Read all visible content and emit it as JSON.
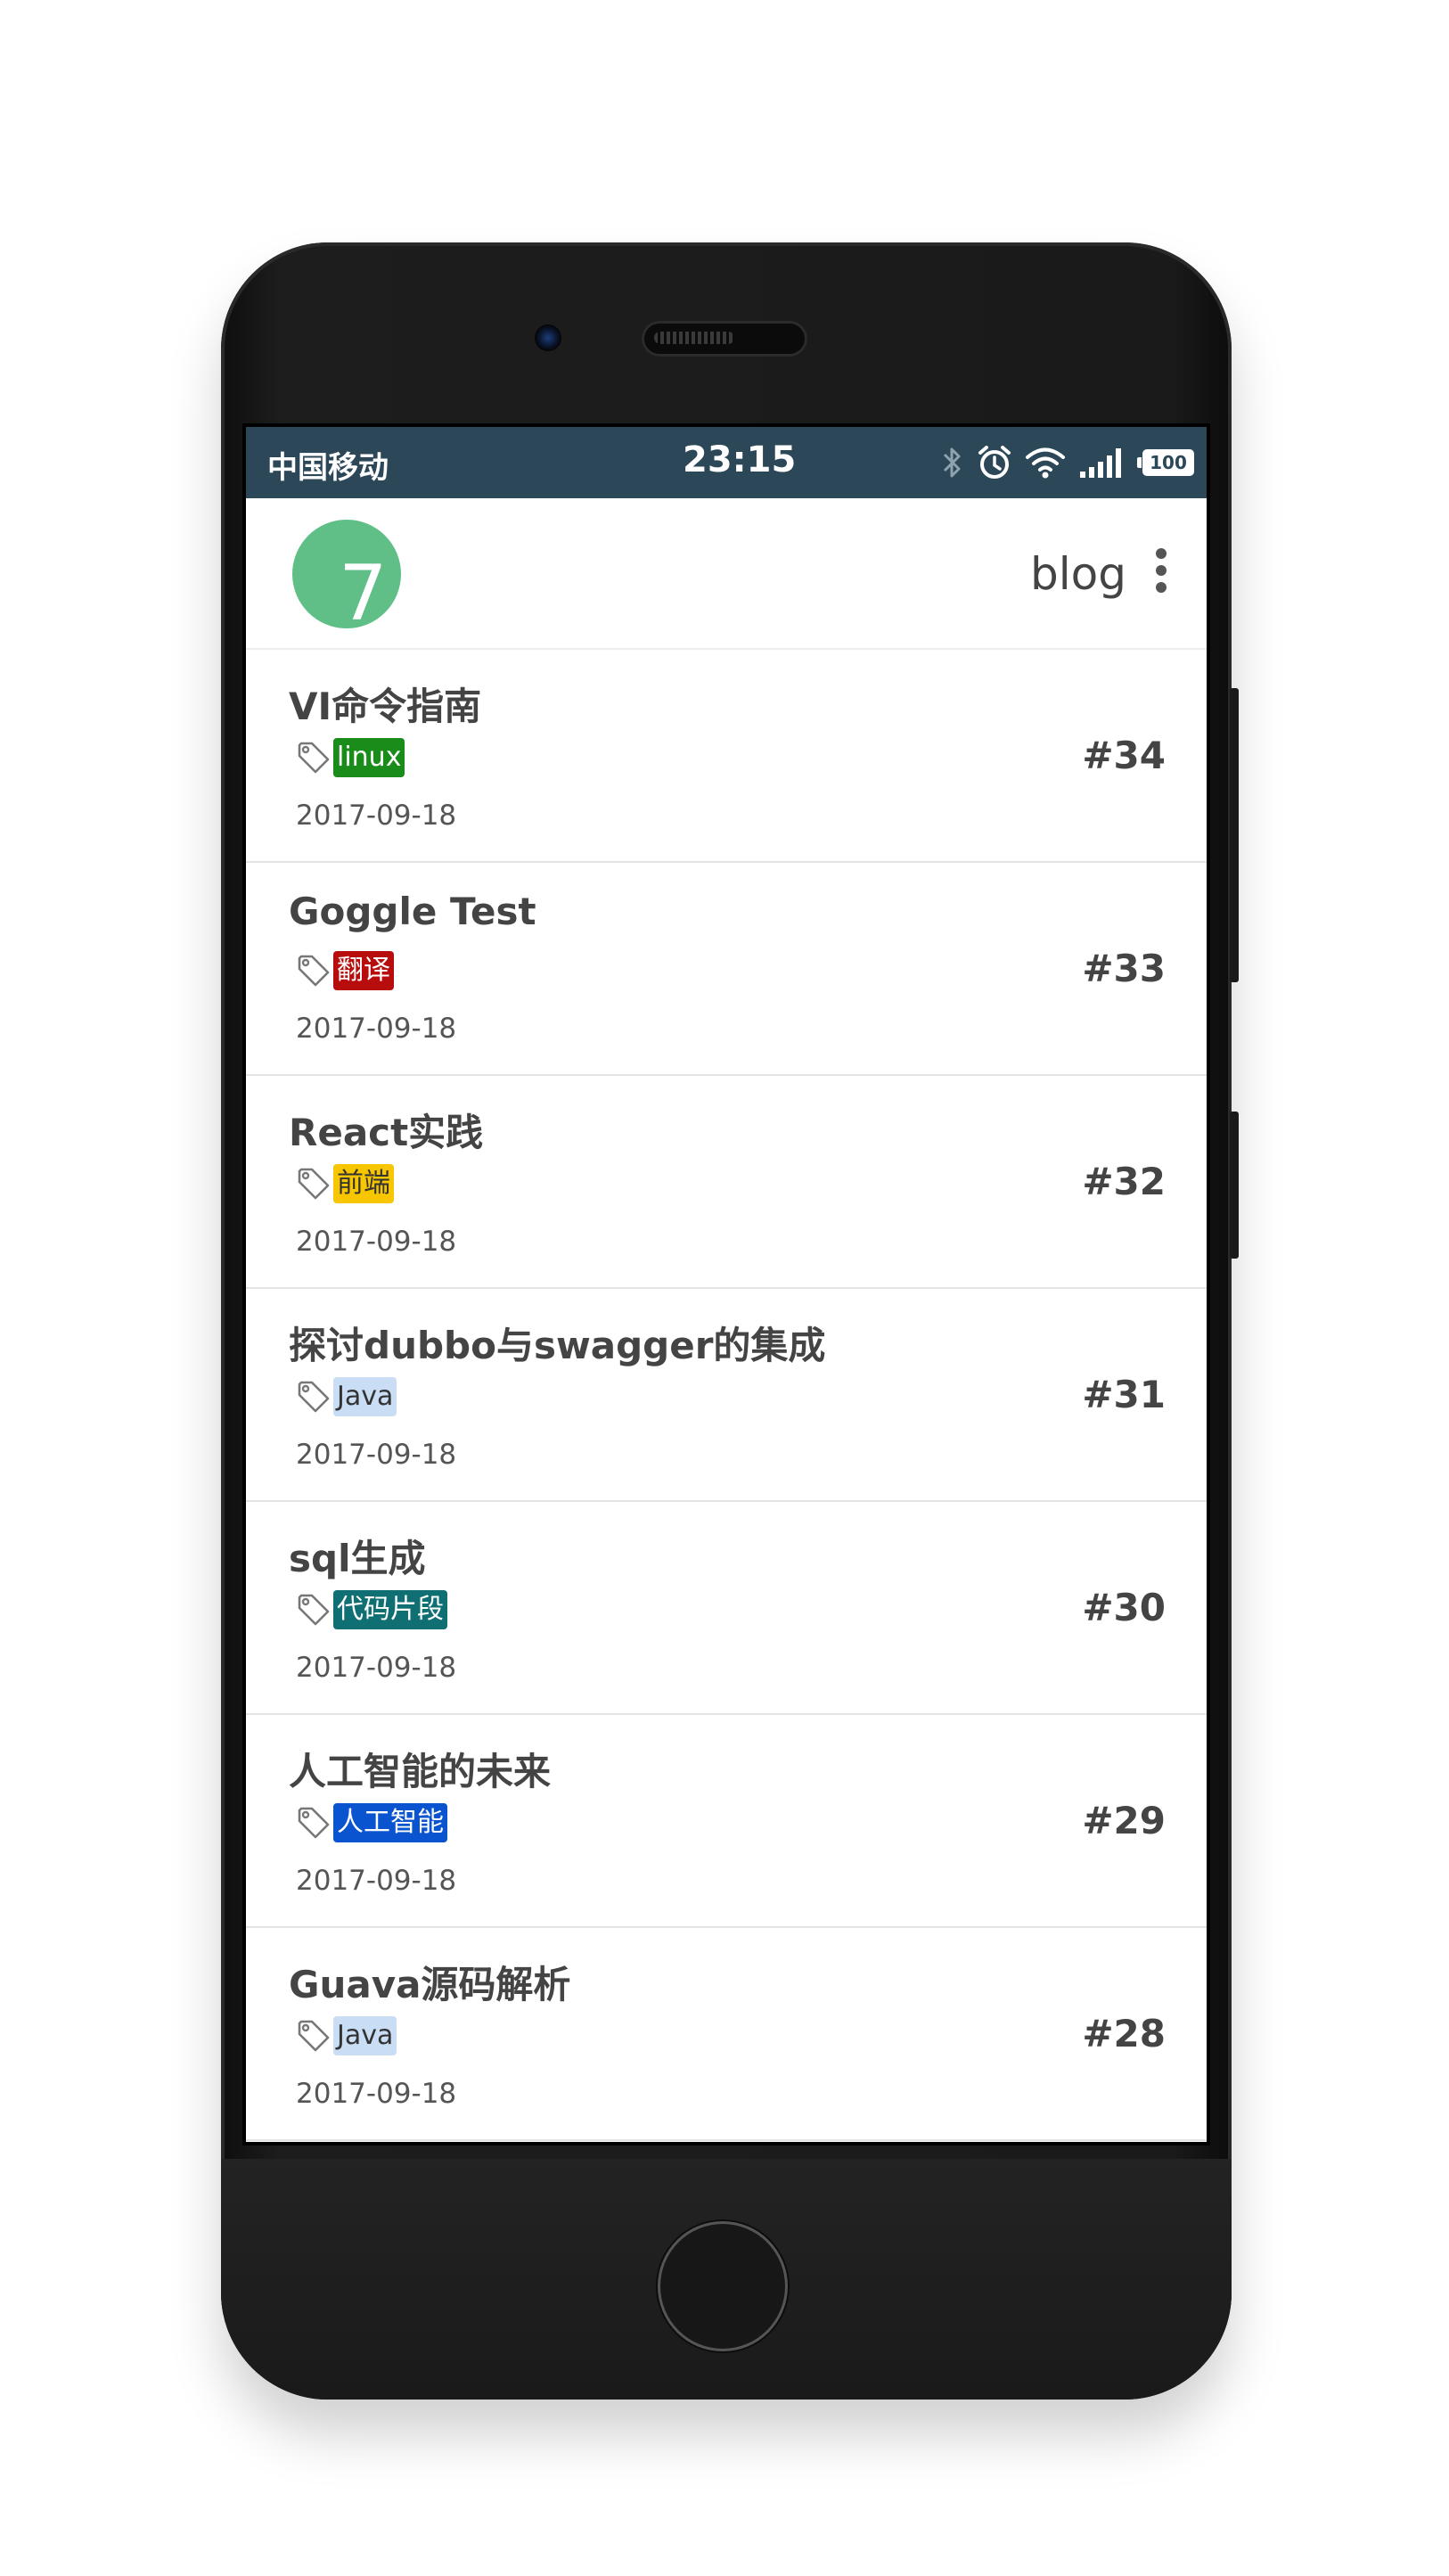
{
  "statusbar": {
    "carrier": "中国移动",
    "time": "23:15",
    "battery": "100",
    "icons": [
      "bluetooth-icon",
      "alarm-icon",
      "wifi-icon",
      "signal-icon",
      "battery-icon"
    ]
  },
  "header": {
    "avatar_text": "7",
    "avatar_color": "#5fbf87",
    "title": "blog",
    "menu_icon": "more-vert-icon"
  },
  "posts": [
    {
      "title": "VI命令指南",
      "tag": "linux",
      "tag_bg": "#1a8c1a",
      "tag_fg": "#ffffff",
      "date": "2017-09-18",
      "number": "#34"
    },
    {
      "title": "Goggle Test",
      "tag": "翻译",
      "tag_bg": "#b80d0d",
      "tag_fg": "#ffffff",
      "date": "2017-09-18",
      "number": "#33"
    },
    {
      "title": "React实践",
      "tag": "前端",
      "tag_bg": "#f7c600",
      "tag_fg": "#333333",
      "date": "2017-09-18",
      "number": "#32"
    },
    {
      "title": "探讨dubbo与swagger的集成",
      "tag": "Java",
      "tag_bg": "#c9def5",
      "tag_fg": "#333333",
      "date": "2017-09-18",
      "number": "#31"
    },
    {
      "title": "sql生成",
      "tag": "代码片段",
      "tag_bg": "#0f6f73",
      "tag_fg": "#ffffff",
      "date": "2017-09-18",
      "number": "#30"
    },
    {
      "title": "人工智能的未来",
      "tag": "人工智能",
      "tag_bg": "#0a55cf",
      "tag_fg": "#ffffff",
      "date": "2017-09-18",
      "number": "#29"
    },
    {
      "title": "Guava源码解析",
      "tag": "Java",
      "tag_bg": "#c9def5",
      "tag_fg": "#333333",
      "date": "2017-09-18",
      "number": "#28"
    }
  ]
}
